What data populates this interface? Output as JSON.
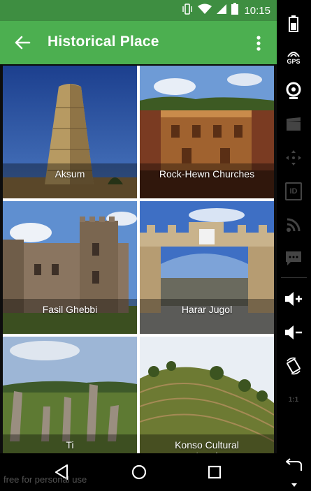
{
  "status_bar": {
    "time": "10:15",
    "icons": [
      "vibrate-icon",
      "wifi-icon",
      "signal-icon",
      "battery-icon"
    ]
  },
  "app_bar": {
    "title": "Historical Place",
    "back_icon": "arrow-left-icon",
    "menu_icon": "more-vert-icon"
  },
  "places": [
    {
      "name": "Aksum"
    },
    {
      "name": "Rock-Hewn Churches"
    },
    {
      "name": "Fasil Ghebbi"
    },
    {
      "name": "Harar Jugol"
    },
    {
      "name": "Ti"
    },
    {
      "name": "Konso Cultural\nLand"
    }
  ],
  "nav_bar": {
    "buttons": [
      "back-triangle-icon",
      "home-circle-icon",
      "recents-square-icon"
    ]
  },
  "watermark": "free for personal use",
  "emulator_sidebar": {
    "gps_label": "GPS",
    "id_label": "ID",
    "ratio_label": "1:1",
    "icons": [
      "battery-icon",
      "gps-icon",
      "camera-icon",
      "clapper-icon",
      "move-icon",
      "id-icon",
      "rss-icon",
      "sms-icon",
      "volume-up-icon",
      "volume-down-icon",
      "rotate-icon",
      "scale-icon",
      "back-arrow-icon"
    ]
  },
  "colors": {
    "status_bar": "#3e8e41",
    "app_bar": "#4caf50",
    "caption_overlay": "rgba(0,0,0,0.35)"
  }
}
